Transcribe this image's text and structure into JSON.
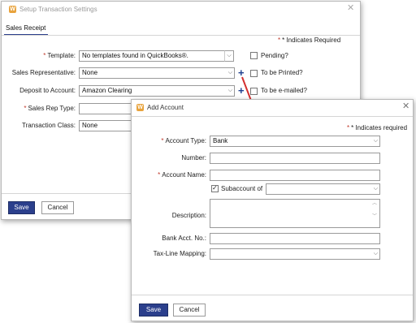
{
  "setup_dialog": {
    "title": "Setup Transaction Settings",
    "tab": "Sales Receipt",
    "required_note": "* Indicates Required",
    "template_label": "Template:",
    "template_value": "No templates found in QuickBooks®.",
    "pending_label": "Pending?",
    "sales_rep_label": "Sales Representative:",
    "sales_rep_value": "None",
    "printed_label": "To be Printed?",
    "deposit_label": "Deposit to Account:",
    "deposit_value": "Amazon Clearing",
    "emailed_label": "To be e-mailed?",
    "sales_rep_type_label": "Sales Rep Type:",
    "sales_rep_type_value": "",
    "trans_class_label": "Transaction Class:",
    "trans_class_value": "None",
    "save_label": "Save",
    "cancel_label": "Cancel"
  },
  "add_account_dialog": {
    "title": "Add Account",
    "required_note": "* Indicates required",
    "account_type_label": "Account Type:",
    "account_type_value": "Bank",
    "number_label": "Number:",
    "number_value": "",
    "account_name_label": "Account Name:",
    "account_name_value": "",
    "subaccount_label": "Subaccount of",
    "subaccount_checked": true,
    "subaccount_value": "",
    "description_label": "Description:",
    "description_value": "",
    "bank_acct_label": "Bank Acct. No.:",
    "bank_acct_value": "",
    "tax_line_label": "Tax-Line Mapping:",
    "tax_line_value": "",
    "save_label": "Save",
    "cancel_label": "Cancel"
  },
  "annotation": {
    "arrow_color": "#d32f2f"
  },
  "icons": {
    "logo": "app-logo-icon",
    "close": "close-icon",
    "dropdown": "chevron-down-icon",
    "add": "plus-icon"
  },
  "colors": {
    "primary_button": "#2b3f8c",
    "required_star": "#c0392b",
    "plus_icon": "#1e3f8f"
  }
}
